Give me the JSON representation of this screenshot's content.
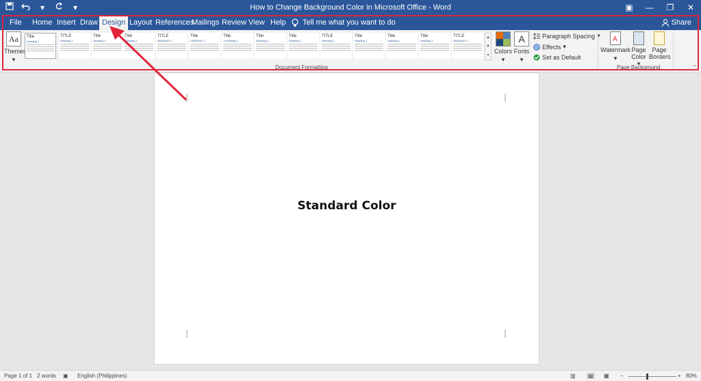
{
  "window": {
    "title": "How to Change Background Color in Microsoft Office  -  Word"
  },
  "quick_access": {
    "save_icon": "save-icon",
    "undo_icon": "undo-icon",
    "redo_icon": "redo-icon"
  },
  "tabs": [
    {
      "label": "File"
    },
    {
      "label": "Home"
    },
    {
      "label": "Insert"
    },
    {
      "label": "Draw"
    },
    {
      "label": "Design",
      "active": true
    },
    {
      "label": "Layout"
    },
    {
      "label": "References"
    },
    {
      "label": "Mailings"
    },
    {
      "label": "Review"
    },
    {
      "label": "View"
    },
    {
      "label": "Help"
    }
  ],
  "tellme": {
    "label": "Tell me what you want to do"
  },
  "share": {
    "label": "Share"
  },
  "ribbon": {
    "themes_label": "Themes",
    "style_gallery": [
      {
        "title": "Title",
        "sub": "Heading 1"
      },
      {
        "title": "TITLE",
        "sub": "Heading 1"
      },
      {
        "title": "Title",
        "sub": "Heading 1"
      },
      {
        "title": "Title",
        "sub": "Heading 1"
      },
      {
        "title": "TITLE",
        "sub": "HEADING 1"
      },
      {
        "title": "Title",
        "sub": "HEADING 1"
      },
      {
        "title": "Title",
        "sub": "1   Heading 1"
      },
      {
        "title": "Title",
        "sub": "Heading 1"
      },
      {
        "title": "Title",
        "sub": "Heading 1"
      },
      {
        "title": "TITLE",
        "sub": "Heading 1"
      },
      {
        "title": "Title",
        "sub": "Heading 1"
      },
      {
        "title": "Title",
        "sub": "Heading 1"
      },
      {
        "title": "Title",
        "sub": "Heading 1"
      },
      {
        "title": "TITLE",
        "sub": "HEADING 1"
      }
    ],
    "document_formatting_label": "Document Formatting",
    "colors_label": "Colors",
    "fonts_label": "Fonts",
    "fonts_glyph": "A",
    "paragraph_spacing_label": "Paragraph Spacing",
    "effects_label": "Effects",
    "set_as_default_label": "Set as Default",
    "watermark_label": "Watermark",
    "page_color_label_1": "Page",
    "page_color_label_2": "Color",
    "page_borders_label_1": "Page",
    "page_borders_label_2": "Borders",
    "page_background_label": "Page Background",
    "theme_colors": [
      "#e46c0a",
      "#4f81bd",
      "#1f497d",
      "#9bbb59"
    ]
  },
  "document": {
    "text": "Standard Color"
  },
  "status": {
    "page": "Page 1 of 1",
    "words": "2 words",
    "language": "English (Philippines)",
    "zoom": "80%"
  },
  "colors": {
    "accent": "#2b579a",
    "highlight": "#e0243a"
  }
}
